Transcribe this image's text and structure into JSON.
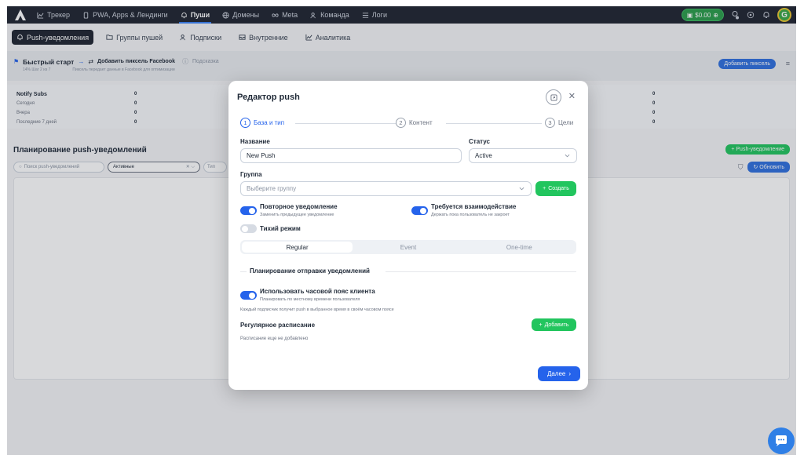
{
  "topnav": {
    "items": [
      {
        "label": "Трекер",
        "icon": "chart-icon"
      },
      {
        "label": "PWA, Apps & Лендинги",
        "icon": "phone-icon"
      },
      {
        "label": "Пуши",
        "icon": "bell-icon"
      },
      {
        "label": "Домены",
        "icon": "globe-icon"
      },
      {
        "label": "Meta",
        "icon": "infinity-icon"
      },
      {
        "label": "Команда",
        "icon": "team-icon"
      },
      {
        "label": "Логи",
        "icon": "list-icon"
      }
    ],
    "balance": "$0.00",
    "avatar_letter": "G"
  },
  "subtabs": [
    {
      "label": "Push-уведомления",
      "icon": "bell-icon"
    },
    {
      "label": "Группы пушей",
      "icon": "folder-icon"
    },
    {
      "label": "Подписки",
      "icon": "users-icon"
    },
    {
      "label": "Внутренние",
      "icon": "inbox-icon"
    },
    {
      "label": "Аналитика",
      "icon": "analytics-icon"
    }
  ],
  "quickstart": {
    "title": "Быстрый старт",
    "step_label": "Добавить пиксель Facebook",
    "hint": "Подсказка",
    "progress": "14%",
    "progress_step": "Шаг 2 из 7",
    "step_desc": "Пиксель передает данные в Facebook для оптимизации",
    "add_pixel": "Добавить пиксель"
  },
  "stats": {
    "header": "Notify Subs",
    "rows": [
      {
        "label": "Notify Subs",
        "value": "0",
        "value2": "0"
      },
      {
        "label": "Сегодня",
        "value": "0",
        "value2": "0"
      },
      {
        "label": "Вчера",
        "value": "0",
        "value2": "0"
      },
      {
        "label": "Последние 7 дней",
        "value": "0",
        "value2": "0"
      }
    ]
  },
  "planning": {
    "title": "Планирование push-уведомлений",
    "add_button": "+ Push-уведомление",
    "search_placeholder": "Поиск push-уведомлений",
    "filter_value": "Активные",
    "type_placeholder": "Тип",
    "refresh": "Обновить"
  },
  "modal": {
    "title": "Редактор push",
    "steps": [
      {
        "num": "1",
        "label": "База и тип"
      },
      {
        "num": "2",
        "label": "Контент"
      },
      {
        "num": "3",
        "label": "Цели"
      }
    ],
    "name_label": "Название",
    "name_value": "New Push",
    "status_label": "Статус",
    "status_value": "Active",
    "group_label": "Группа",
    "group_placeholder": "Выберите группу",
    "create_button": "Создать",
    "repeat_title": "Повторное уведомление",
    "repeat_sub": "Заменить предыдущее уведомление",
    "interaction_title": "Требуется взаимодействие",
    "interaction_sub": "Держать пока пользователь не закроет",
    "silent_title": "Тихий режим",
    "segments": [
      "Regular",
      "Event",
      "One-time"
    ],
    "schedule_section": "Планирование отправки уведомлений",
    "tz_title": "Использовать часовой пояс клиента",
    "tz_sub": "Планировать по местному времени пользователя",
    "tz_note": "Каждый подписчик получит push в выбранное время в своём часовом поясе",
    "regular_label": "Регулярное расписание",
    "add_button": "Добавить",
    "empty_text": "Расписание еще не добавлено",
    "next_button": "Далее"
  },
  "colors": {
    "nav_bg": "#1f2430",
    "primary": "#2563eb",
    "success": "#22c55e"
  }
}
